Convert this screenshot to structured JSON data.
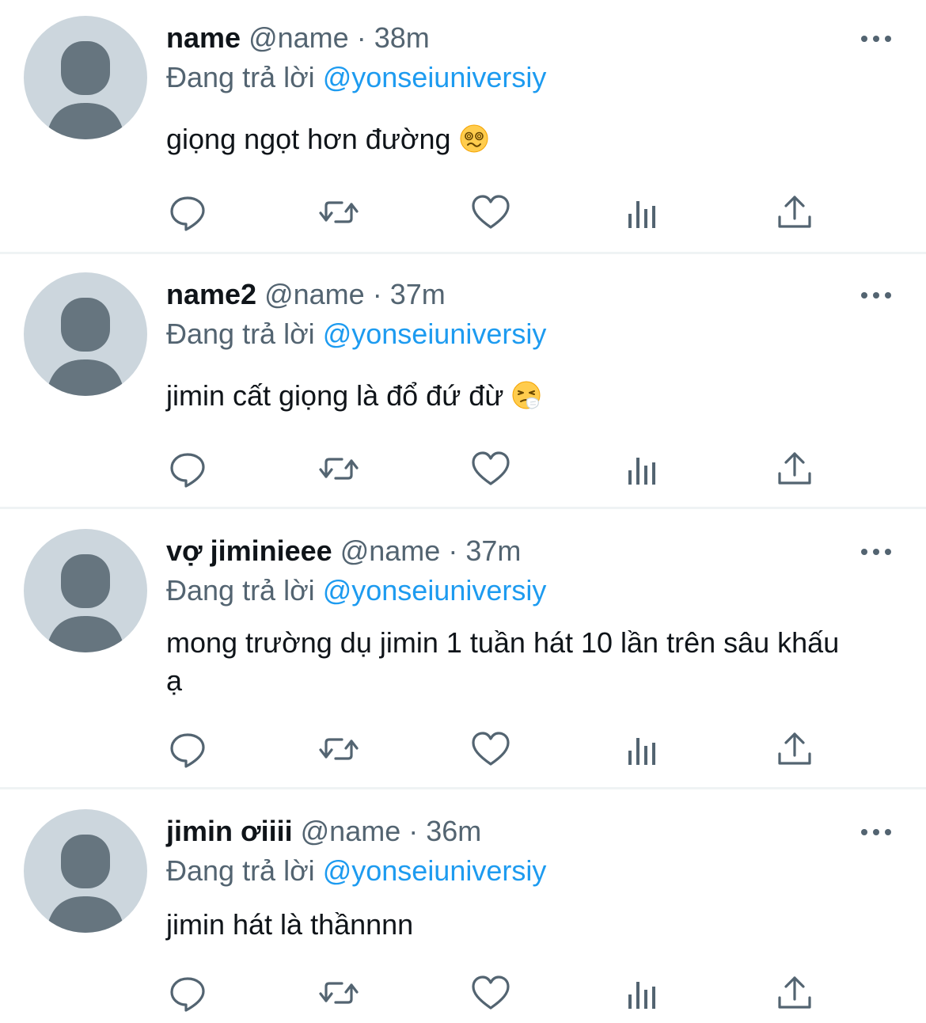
{
  "tweets": [
    {
      "name": "name",
      "handle": "@name",
      "separator": "·",
      "time": "38m",
      "reply_prefix": "Đang trả lời",
      "reply_to": "@yonseiuniversiy",
      "text": "giọng ngọt hơn đường",
      "emoji": "woozy-face"
    },
    {
      "name": "name2",
      "handle": "@name",
      "separator": "·",
      "time": "37m",
      "reply_prefix": "Đang trả lời",
      "reply_to": "@yonseiuniversiy",
      "text": "jimin cất giọng là đổ đứ đừ",
      "emoji": "sneezing-face"
    },
    {
      "name": "vợ jiminieee",
      "handle": "@name",
      "separator": "·",
      "time": "37m",
      "reply_prefix": "Đang trả lời",
      "reply_to": "@yonseiuniversiy",
      "text": "mong trường dụ jimin 1 tuần hát 10 lần trên sâu khấu ạ",
      "emoji": ""
    },
    {
      "name": "jimin ơiiii",
      "handle": "@name",
      "separator": "·",
      "time": "36m",
      "reply_prefix": "Đang trả lời",
      "reply_to": "@yonseiuniversiy",
      "text": "jimin hát là thầnnnn",
      "emoji": ""
    }
  ],
  "icons": {
    "reply": "speech-bubble-icon",
    "retweet": "retweet-arrows-icon",
    "like": "heart-icon",
    "views": "bar-chart-icon",
    "share": "upload-share-icon",
    "more": "more-dots-icon"
  },
  "colors": {
    "text": "#0f1419",
    "secondary": "#536471",
    "link": "#1d9bf0",
    "icon": "#536471",
    "avatar_bg": "#ccd6dd",
    "avatar_fg": "#66757f",
    "divider": "#eff3f4"
  }
}
